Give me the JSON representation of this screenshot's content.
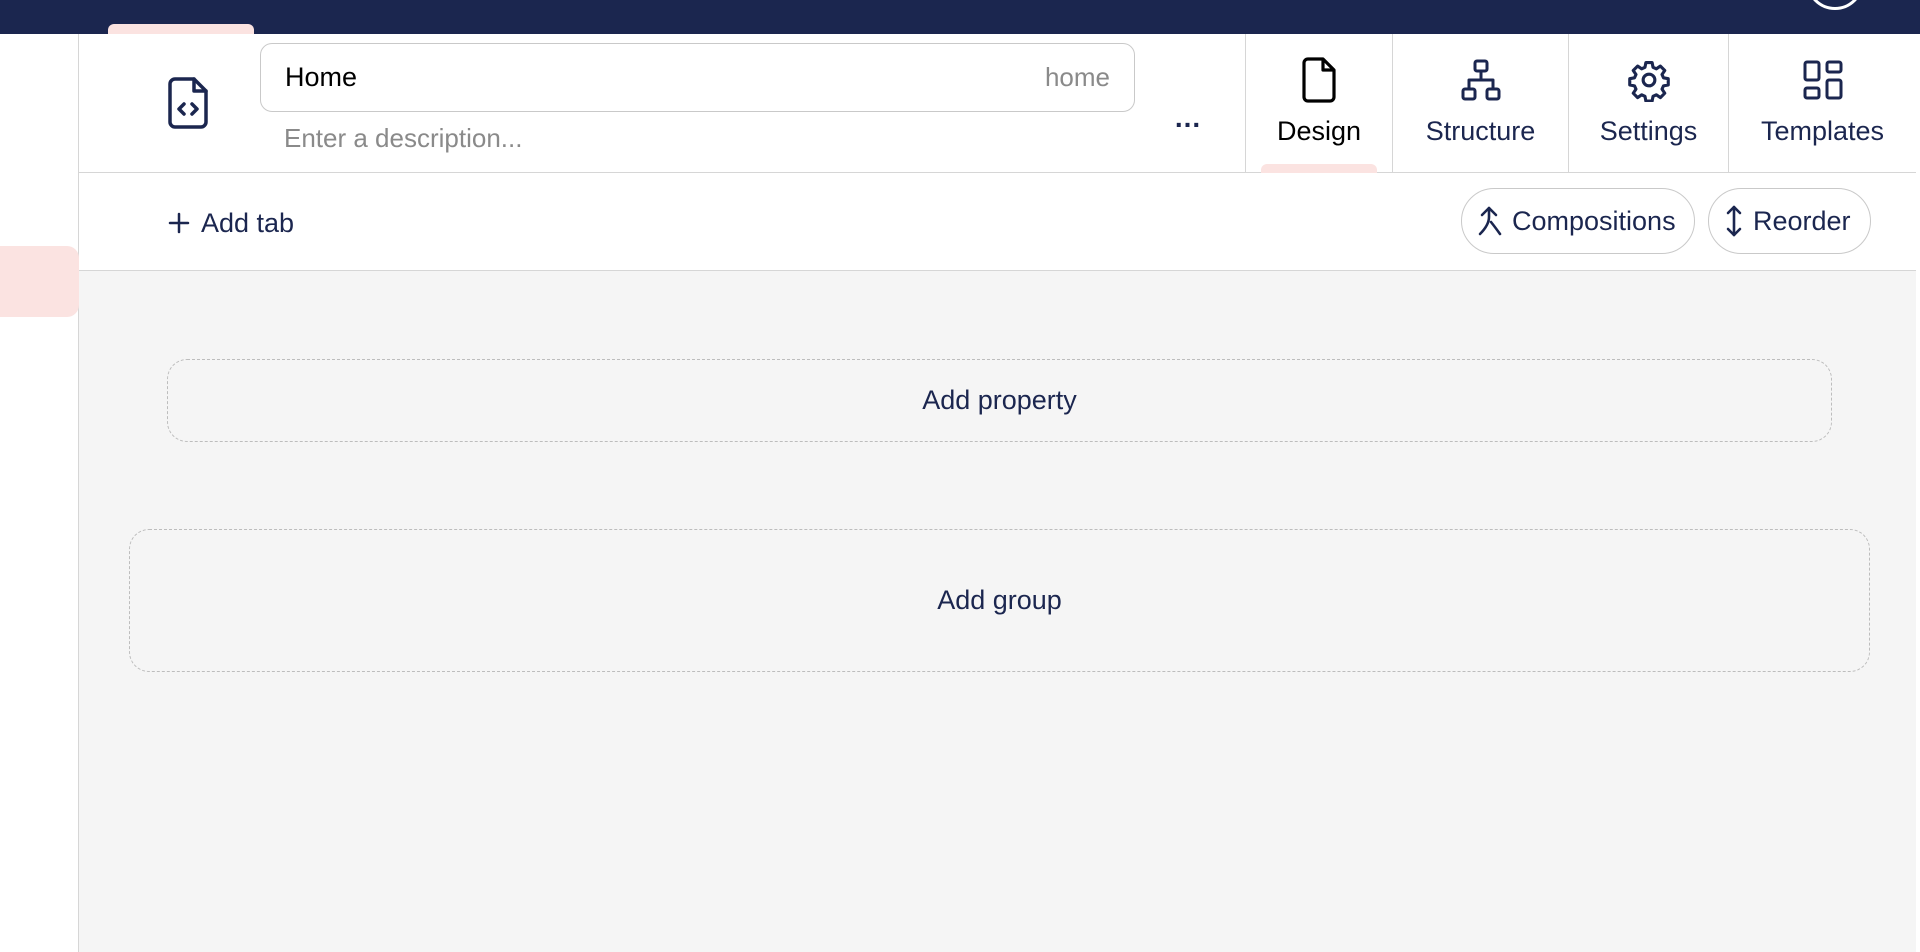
{
  "header": {
    "name_value": "Home",
    "alias": "home",
    "description_placeholder": "Enter a description...",
    "more_label": "..."
  },
  "view_tabs": [
    {
      "label": "Design",
      "icon": "file-icon",
      "active": true
    },
    {
      "label": "Structure",
      "icon": "sitemap-icon",
      "active": false
    },
    {
      "label": "Settings",
      "icon": "gear-icon",
      "active": false
    },
    {
      "label": "Templates",
      "icon": "grid-icon",
      "active": false
    }
  ],
  "toolbar": {
    "add_tab_label": "Add tab",
    "compositions_label": "Compositions",
    "reorder_label": "Reorder"
  },
  "canvas": {
    "add_property_label": "Add property",
    "add_group_label": "Add group"
  },
  "colors": {
    "navy": "#1b264f",
    "accent_pink": "#fbe3e1",
    "canvas_bg": "#f5f5f5",
    "border": "#d6d6d6"
  }
}
